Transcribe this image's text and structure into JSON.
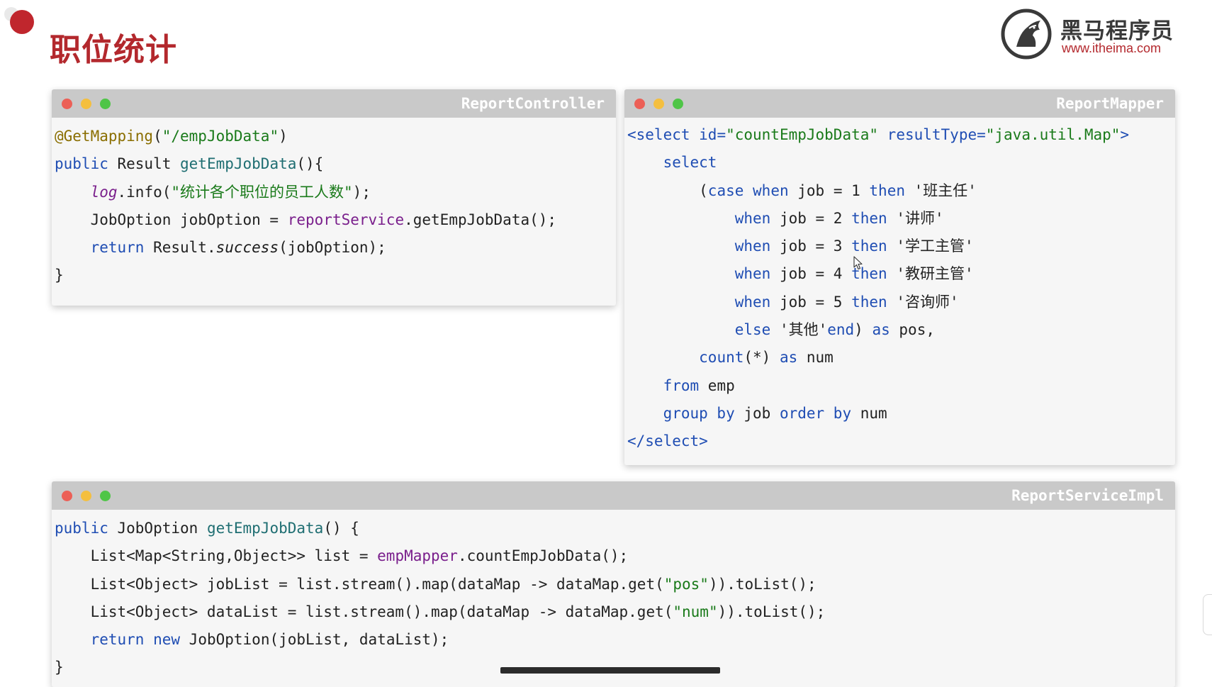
{
  "page": {
    "title": "职位统计",
    "logo": {
      "name": "黑马程序员",
      "url": "www.itheima.com"
    }
  },
  "colors": {
    "brand_red": "#b3282d",
    "keyword_blue": "#1f4db3",
    "string_green": "#1a7a1a",
    "annotation": "#8a6e00",
    "field_purple": "#7a1f8c",
    "titlebar_gray": "#c9c9c9",
    "traffic_red": "#ec5f56",
    "traffic_yellow": "#f4bf3f",
    "traffic_green": "#4fc547"
  },
  "windows": {
    "controller": {
      "title": "ReportController",
      "lines": [
        [
          {
            "t": "@GetMapping",
            "c": "a"
          },
          {
            "t": "(",
            "c": "d"
          },
          {
            "t": "\"/empJobData\"",
            "c": "s"
          },
          {
            "t": ")",
            "c": "d"
          }
        ],
        [
          {
            "t": "public",
            "c": "k"
          },
          {
            "t": " Result ",
            "c": "d"
          },
          {
            "t": "getEmpJobData",
            "c": "f"
          },
          {
            "t": "(){",
            "c": "d"
          }
        ],
        [
          {
            "t": "    ",
            "c": "d"
          },
          {
            "t": "log",
            "c": "p i"
          },
          {
            "t": ".info(",
            "c": "d"
          },
          {
            "t": "\"统计各个职位的员工人数\"",
            "c": "s"
          },
          {
            "t": ");",
            "c": "d"
          }
        ],
        [
          {
            "t": "    JobOption jobOption = ",
            "c": "d"
          },
          {
            "t": "reportService",
            "c": "p"
          },
          {
            "t": ".getEmpJobData();",
            "c": "d"
          }
        ],
        [
          {
            "t": "    ",
            "c": "d"
          },
          {
            "t": "return",
            "c": "k"
          },
          {
            "t": " Result.",
            "c": "d"
          },
          {
            "t": "success",
            "c": "i"
          },
          {
            "t": "(jobOption);",
            "c": "d"
          }
        ],
        [
          {
            "t": "}",
            "c": "d"
          }
        ]
      ]
    },
    "mapper": {
      "title": "ReportMapper",
      "lines": [
        [
          {
            "t": "<select ",
            "c": "k"
          },
          {
            "t": "id=",
            "c": "k"
          },
          {
            "t": "\"countEmpJobData\"",
            "c": "s"
          },
          {
            "t": " resultType=",
            "c": "k"
          },
          {
            "t": "\"java.util.Map\"",
            "c": "s"
          },
          {
            "t": ">",
            "c": "k"
          }
        ],
        [
          {
            "t": "    ",
            "c": "d"
          },
          {
            "t": "select",
            "c": "k"
          }
        ],
        [
          {
            "t": "        (",
            "c": "d"
          },
          {
            "t": "case",
            "c": "k"
          },
          {
            "t": " ",
            "c": "d"
          },
          {
            "t": "when",
            "c": "k"
          },
          {
            "t": " job = 1 ",
            "c": "d"
          },
          {
            "t": "then",
            "c": "k"
          },
          {
            "t": " '班主任'",
            "c": "d"
          }
        ],
        [
          {
            "t": "            ",
            "c": "d"
          },
          {
            "t": "when",
            "c": "k"
          },
          {
            "t": " job = 2 ",
            "c": "d"
          },
          {
            "t": "then",
            "c": "k"
          },
          {
            "t": " '讲师'",
            "c": "d"
          }
        ],
        [
          {
            "t": "            ",
            "c": "d"
          },
          {
            "t": "when",
            "c": "k"
          },
          {
            "t": " job = 3 ",
            "c": "d"
          },
          {
            "t": "then",
            "c": "k"
          },
          {
            "t": " '学工主管'",
            "c": "d"
          }
        ],
        [
          {
            "t": "            ",
            "c": "d"
          },
          {
            "t": "when",
            "c": "k"
          },
          {
            "t": " job = 4 ",
            "c": "d"
          },
          {
            "t": "then",
            "c": "k"
          },
          {
            "t": " '教研主管'",
            "c": "d"
          }
        ],
        [
          {
            "t": "            ",
            "c": "d"
          },
          {
            "t": "when",
            "c": "k"
          },
          {
            "t": " job = 5 ",
            "c": "d"
          },
          {
            "t": "then",
            "c": "k"
          },
          {
            "t": " '咨询师'",
            "c": "d"
          }
        ],
        [
          {
            "t": "            ",
            "c": "d"
          },
          {
            "t": "else",
            "c": "k"
          },
          {
            "t": " '其他'",
            "c": "d"
          },
          {
            "t": "end",
            "c": "k"
          },
          {
            "t": ") ",
            "c": "d"
          },
          {
            "t": "as",
            "c": "k"
          },
          {
            "t": " pos,",
            "c": "d"
          }
        ],
        [
          {
            "t": "        ",
            "c": "d"
          },
          {
            "t": "count",
            "c": "k"
          },
          {
            "t": "(*) ",
            "c": "d"
          },
          {
            "t": "as",
            "c": "k"
          },
          {
            "t": " num",
            "c": "d"
          }
        ],
        [
          {
            "t": "    ",
            "c": "d"
          },
          {
            "t": "from",
            "c": "k"
          },
          {
            "t": " emp",
            "c": "d"
          }
        ],
        [
          {
            "t": "    ",
            "c": "d"
          },
          {
            "t": "group by",
            "c": "k"
          },
          {
            "t": " job ",
            "c": "d"
          },
          {
            "t": "order by",
            "c": "k"
          },
          {
            "t": " num",
            "c": "d"
          }
        ],
        [
          {
            "t": "</select>",
            "c": "k"
          }
        ]
      ]
    },
    "service": {
      "title": "ReportServiceImpl",
      "lines": [
        [
          {
            "t": "public",
            "c": "k"
          },
          {
            "t": " JobOption ",
            "c": "d"
          },
          {
            "t": "getEmpJobData",
            "c": "f"
          },
          {
            "t": "() {",
            "c": "d"
          }
        ],
        [
          {
            "t": "    List<Map<String,Object>> list = ",
            "c": "d"
          },
          {
            "t": "empMapper",
            "c": "p"
          },
          {
            "t": ".countEmpJobData();",
            "c": "d"
          }
        ],
        [
          {
            "t": "    List<Object> jobList = list.stream().map(dataMap -> dataMap.get(",
            "c": "d"
          },
          {
            "t": "\"pos\"",
            "c": "s"
          },
          {
            "t": ")).toList();",
            "c": "d"
          }
        ],
        [
          {
            "t": "    List<Object> dataList = list.stream().map(dataMap -> dataMap.get(",
            "c": "d"
          },
          {
            "t": "\"num\"",
            "c": "s"
          },
          {
            "t": ")).toList();",
            "c": "d"
          }
        ],
        [
          {
            "t": "    ",
            "c": "d"
          },
          {
            "t": "return",
            "c": "k"
          },
          {
            "t": " ",
            "c": "d"
          },
          {
            "t": "new",
            "c": "k"
          },
          {
            "t": " JobOption(jobList, dataList);",
            "c": "d"
          }
        ],
        [
          {
            "t": "}",
            "c": "d"
          }
        ]
      ]
    }
  }
}
